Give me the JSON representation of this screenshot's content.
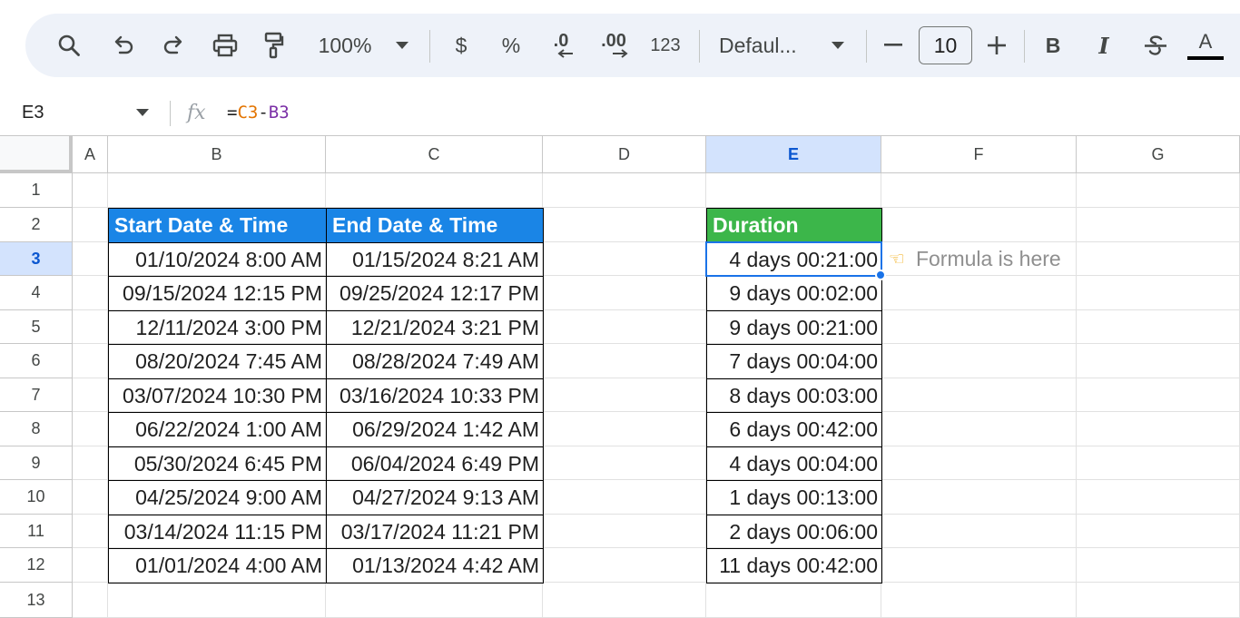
{
  "toolbar": {
    "zoom": "100%",
    "currency_label": "$",
    "percent_label": "%",
    "decrease_decimal_label": ".0",
    "increase_decimal_label": ".00",
    "number_format_label": "123",
    "font_name": "Defaul...",
    "font_size": "10",
    "bold_label": "B",
    "italic_label": "I",
    "text_color_label": "A"
  },
  "formula_bar": {
    "cell_ref": "E3",
    "fx_label": "fx",
    "formula_eq": "=",
    "formula_ref1": "C3",
    "formula_op": "-",
    "formula_ref2": "B3"
  },
  "columns": [
    "A",
    "B",
    "C",
    "D",
    "E",
    "F",
    "G"
  ],
  "rows": [
    "1",
    "2",
    "3",
    "4",
    "5",
    "6",
    "7",
    "8",
    "9",
    "10",
    "11",
    "12",
    "13"
  ],
  "table": {
    "header_start": "Start Date & Time",
    "header_end": "End Date & Time",
    "header_duration": "Duration",
    "rows": [
      {
        "start": "01/10/2024 8:00 AM",
        "end": "01/15/2024 8:21 AM",
        "duration": "4 days 00:21:00"
      },
      {
        "start": "09/15/2024 12:15 PM",
        "end": "09/25/2024 12:17 PM",
        "duration": "9 days 00:02:00"
      },
      {
        "start": "12/11/2024 3:00 PM",
        "end": "12/21/2024 3:21 PM",
        "duration": "9 days 00:21:00"
      },
      {
        "start": "08/20/2024 7:45 AM",
        "end": "08/28/2024 7:49 AM",
        "duration": "7 days 00:04:00"
      },
      {
        "start": "03/07/2024 10:30 PM",
        "end": "03/16/2024 10:33 PM",
        "duration": "8 days 00:03:00"
      },
      {
        "start": "06/22/2024 1:00 AM",
        "end": "06/29/2024 1:42 AM",
        "duration": "6 days 00:42:00"
      },
      {
        "start": "05/30/2024 6:45 PM",
        "end": "06/04/2024 6:49 PM",
        "duration": "4 days 00:04:00"
      },
      {
        "start": "04/25/2024 9:00 AM",
        "end": "04/27/2024 9:13 AM",
        "duration": "1 days 00:13:00"
      },
      {
        "start": "03/14/2024 11:15 PM",
        "end": "03/17/2024 11:21 PM",
        "duration": "2 days 00:06:00"
      },
      {
        "start": "01/01/2024 4:00 AM",
        "end": "01/13/2024 4:42 AM",
        "duration": "11 days 00:42:00"
      }
    ]
  },
  "note": {
    "icon": "pointing-hand-icon",
    "text": "Formula is here"
  },
  "colors": {
    "header_blue": "#1a85e6",
    "header_green": "#3cb64a",
    "selection": "#1a73e8",
    "ref_orange": "#e37400",
    "ref_purple": "#7b2fa6"
  }
}
